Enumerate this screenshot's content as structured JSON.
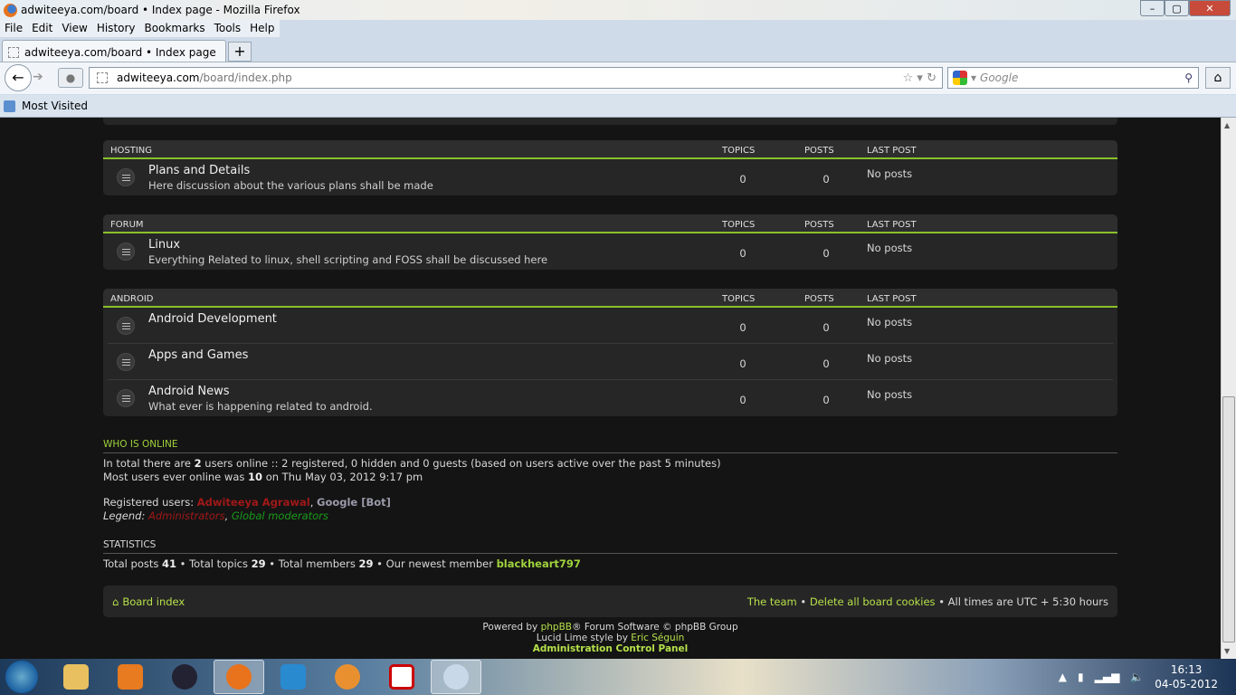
{
  "window": {
    "title": "adwiteeya.com/board • Index page - Mozilla Firefox",
    "minimize": "–",
    "maximize": "▢",
    "close": "✕"
  },
  "menu": [
    "File",
    "Edit",
    "View",
    "History",
    "Bookmarks",
    "Tools",
    "Help"
  ],
  "tab": {
    "label": "adwiteeya.com/board • Index page",
    "new": "+"
  },
  "address": {
    "domain": "adwiteeya.com",
    "path": "/board/index.php"
  },
  "search": {
    "placeholder": "Google"
  },
  "bookmarks": {
    "most_visited": "Most Visited"
  },
  "forum": {
    "columns": {
      "topics": "TOPICS",
      "posts": "POSTS",
      "last": "LAST POST"
    },
    "categories": [
      {
        "name": "HOSTING",
        "forums": [
          {
            "name": "Plans and Details",
            "desc": "Here discussion about the various plans shall be made",
            "topics": "0",
            "posts": "0",
            "last": "No posts"
          }
        ]
      },
      {
        "name": "FORUM",
        "forums": [
          {
            "name": "Linux",
            "desc": "Everything Related to linux, shell scripting and FOSS shall be discussed here",
            "topics": "0",
            "posts": "0",
            "last": "No posts"
          }
        ]
      },
      {
        "name": "ANDROID",
        "forums": [
          {
            "name": "Android Development",
            "desc": "",
            "topics": "0",
            "posts": "0",
            "last": "No posts"
          },
          {
            "name": "Apps and Games",
            "desc": "",
            "topics": "0",
            "posts": "0",
            "last": "No posts"
          },
          {
            "name": "Android News",
            "desc": "What ever is happening related to android.",
            "topics": "0",
            "posts": "0",
            "last": "No posts"
          }
        ]
      }
    ]
  },
  "online": {
    "title": "WHO IS ONLINE",
    "l1a": "In total there are ",
    "count": "2",
    "l1b": " users online :: 2 registered, 0 hidden and 0 guests (based on users active over the past 5 minutes)",
    "l2a": "Most users ever online was ",
    "max": "10",
    "l2b": " on Thu May 03, 2012 9:17 pm",
    "reg_label": "Registered users: ",
    "user1": "Adwiteeya Agrawal",
    "sep": ", ",
    "user2": "Google [Bot]",
    "legend_label": "Legend: ",
    "legend1": "Administrators",
    "legend2": "Global moderators"
  },
  "stats": {
    "title": "STATISTICS",
    "a": "Total posts ",
    "posts": "41",
    "b": " • Total topics ",
    "topics": "29",
    "c": " • Total members ",
    "members": "29",
    "d": " • Our newest member ",
    "newest": "blackheart797"
  },
  "footer": {
    "board_index": "Board index",
    "team": "The team",
    "sep": " • ",
    "cookies": "Delete all board cookies",
    "tz": " • All times are UTC + 5:30 hours"
  },
  "credits": {
    "powered_a": "Powered by ",
    "phpbb": "phpBB",
    "powered_b": "® Forum Software © phpBB Group",
    "style_a": "Lucid Lime style by ",
    "author": "Eric Séguin",
    "acp": "Administration Control Panel"
  },
  "taskbar": {
    "time": "16:13",
    "date": "04-05-2012"
  },
  "colors": {
    "accent": "#9fd23c",
    "admin": "#a01818",
    "moderator": "#1a9a1a"
  }
}
